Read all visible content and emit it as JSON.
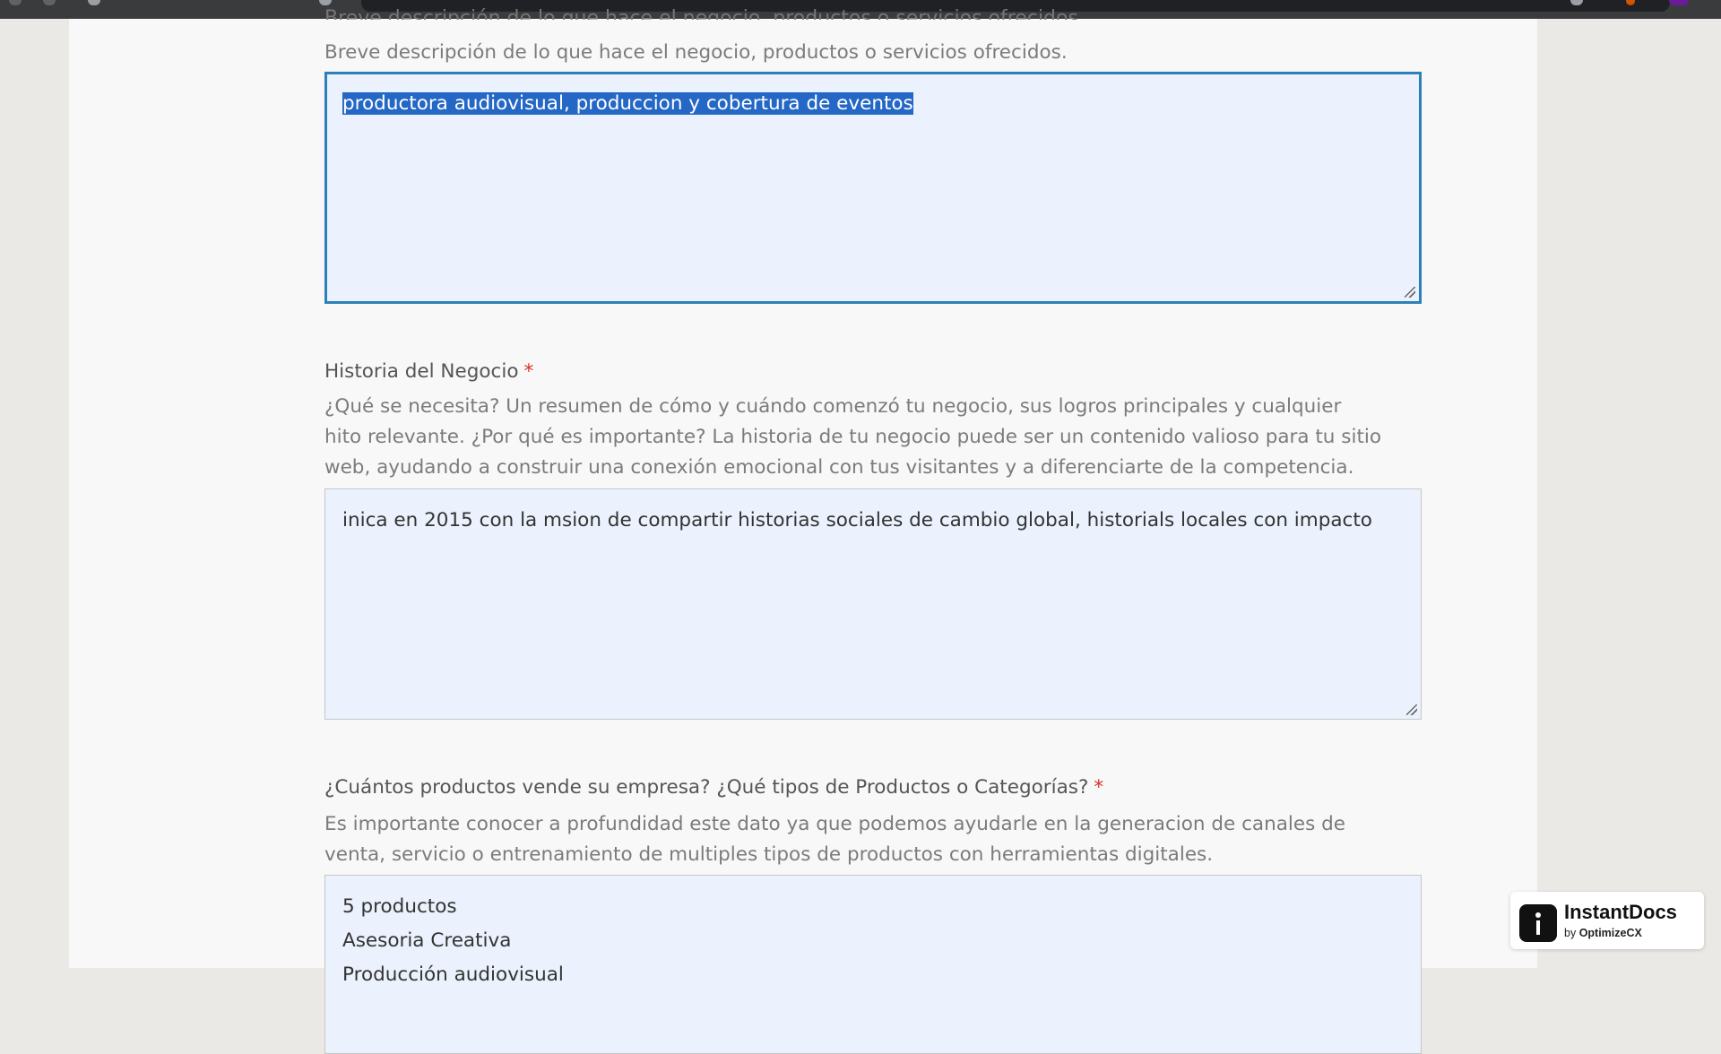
{
  "desc_section": {
    "label_partial": "Breve descripción de lo que hace el negocio, productos o servicios ofrecidos.",
    "help": "Breve descripción de lo que hace el negocio, productos o servicios ofrecidos.",
    "value": "productora audiovisual, produccion y cobertura de eventos"
  },
  "history_section": {
    "label": "Historia del Negocio",
    "required_mark": "*",
    "help": "¿Qué se necesita? Un resumen de cómo y cuándo comenzó tu negocio, sus logros principales y cualquier hito relevante. ¿Por qué es importante? La historia de tu negocio puede ser un contenido valioso para tu sitio web, ayudando a construir una conexión emocional con tus visitantes y a diferenciarte de la competencia.",
    "value": "inica en 2015 con la msion de compartir historias sociales de cambio global, historials locales con impacto"
  },
  "products_section": {
    "label": "¿Cuántos productos vende su empresa? ¿Qué tipos de Productos o Categorías?",
    "required_mark": "*",
    "help": "Es importante conocer a profundidad este dato ya que podemos ayudarle en la generacion de canales de venta, servicio o entrenamiento de multiples tipos de productos con herramientas digitales.",
    "lines": [
      "5 productos",
      "Asesoria Creativa",
      "Producción audiovisual"
    ]
  },
  "badge": {
    "name": "InstantDocs",
    "by_prefix": "by",
    "by_brand": "OptimizeCX"
  }
}
